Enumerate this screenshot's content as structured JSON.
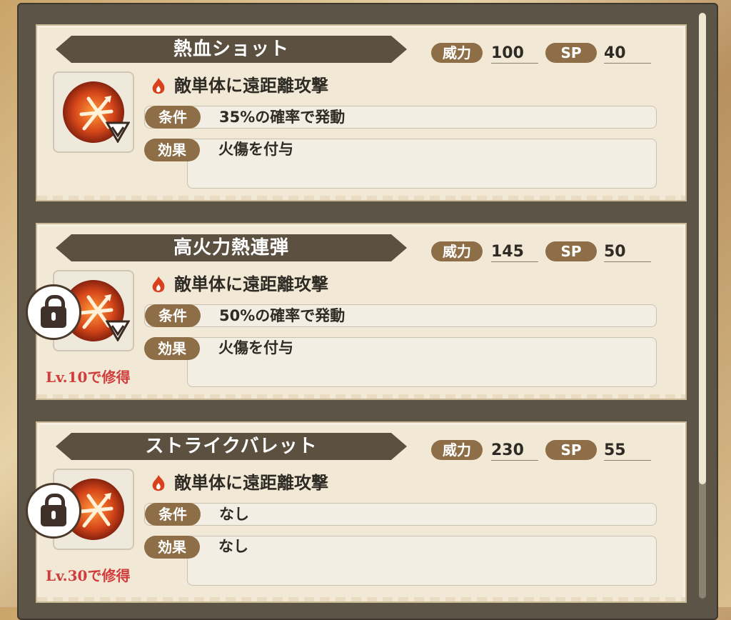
{
  "labels": {
    "power": "威力",
    "sp": "SP",
    "condition": "条件",
    "effect": "効果"
  },
  "skills": [
    {
      "name": "熱血ショット",
      "power": "100",
      "sp": "40",
      "description": "敵単体に遠距離攻撃",
      "condition": "35%の確率で発動",
      "effect": "火傷を付与",
      "locked": false,
      "requirement": ""
    },
    {
      "name": "高火力熱連弾",
      "power": "145",
      "sp": "50",
      "description": "敵単体に遠距離攻撃",
      "condition": "50%の確率で発動",
      "effect": "火傷を付与",
      "locked": true,
      "requirement": "Lv.10で修得"
    },
    {
      "name": "ストライクバレット",
      "power": "230",
      "sp": "55",
      "description": "敵単体に遠距離攻撃",
      "condition": "なし",
      "effect": "なし",
      "locked": true,
      "requirement": "Lv.30で修得"
    }
  ],
  "icons": [
    "fire-element-icon",
    "bullet-skill-icon",
    "debuff-down-icon",
    "lock-icon"
  ],
  "colors": {
    "label_bg": "#8d6e47",
    "banner_bg": "#5c5040",
    "card_bg": "#f2e8d6",
    "requirement_text": "#d03c3c"
  }
}
